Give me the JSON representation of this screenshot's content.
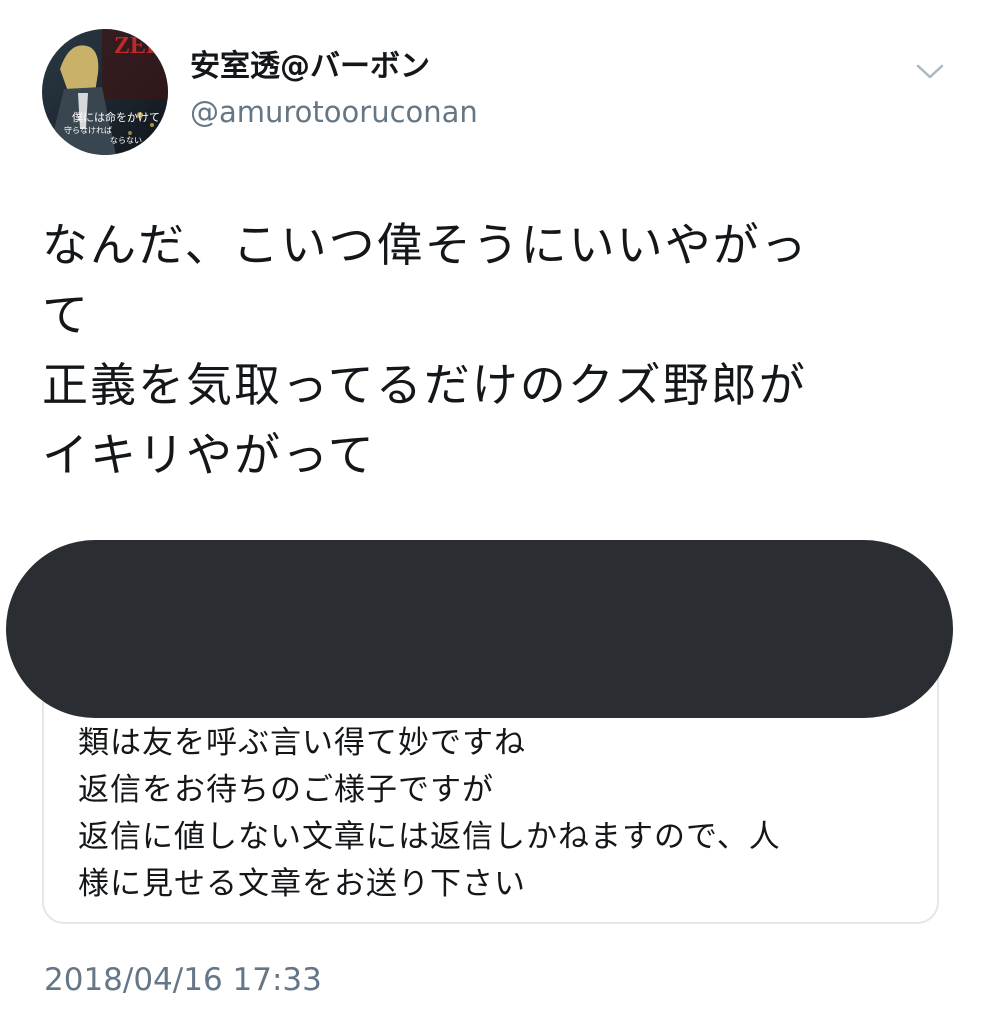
{
  "tweet": {
    "author": {
      "display_name": "安室透@バーボン",
      "handle": "@amurotooruconan",
      "avatar": {
        "banner_text": "ZERO",
        "text_lines": [
          "僕には命をかけて",
          "守らなければ",
          "ならない"
        ]
      }
    },
    "menu_icon": "chevron-down-icon",
    "text_lines": [
      "なんだ、こいつ偉そうにいいやがっ",
      "て",
      "正義を気取ってるだけのクズ野郎が",
      "イキリやがって"
    ],
    "quoted_tweet": {
      "text_lines": [
        "類は友を呼ぶ言い得て妙ですね",
        "返信をお待ちのご様子ですが",
        "返信に値しない文章には返信しかねますので、人",
        "様に見せる文章をお送り下さい"
      ]
    },
    "timestamp": "2018/04/16 17:33"
  },
  "colors": {
    "text_primary": "#14171a",
    "text_secondary": "#657786",
    "card_border": "#e1e8ed",
    "redaction": "#2a2e32"
  }
}
